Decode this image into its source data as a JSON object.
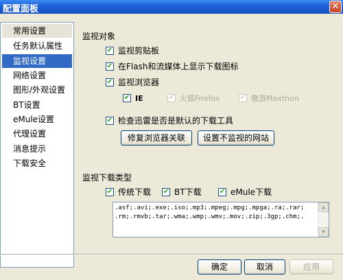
{
  "window": {
    "title": "配置面板",
    "close_icon": "✕"
  },
  "nav": {
    "items": [
      {
        "label": "常用设置"
      },
      {
        "label": "任务默认属性"
      },
      {
        "label": "监视设置"
      },
      {
        "label": "网络设置"
      },
      {
        "label": "图形/外观设置"
      },
      {
        "label": "BT设置"
      },
      {
        "label": "eMule设置"
      },
      {
        "label": "代理设置"
      },
      {
        "label": "消息提示"
      },
      {
        "label": "下载安全"
      }
    ],
    "selected": "监视设置"
  },
  "monitor_objects": {
    "title": "监视对象",
    "clipboard": {
      "label": "监视剪贴板",
      "checked": true
    },
    "flash": {
      "label": "在Flash和流媒体上显示下载图标",
      "checked": true
    },
    "browser": {
      "label": "监视浏览器",
      "checked": true
    },
    "ie": {
      "label": "IE",
      "checked": true
    },
    "firefox": {
      "label": "火狐Firefox",
      "checked": true,
      "disabled": true
    },
    "maxthon": {
      "label": "傲游Maxthon",
      "checked": true,
      "disabled": true
    },
    "default_tool": {
      "label": "检查迅雷是否是默认的下载工具",
      "checked": true
    },
    "repair_button": "修复浏览器关联",
    "unmonitored_sites_button": "设置不监视的网站"
  },
  "download_types": {
    "title": "监视下载类型",
    "traditional": {
      "label": "传统下载",
      "checked": true
    },
    "bt": {
      "label": "BT下载",
      "checked": true
    },
    "emule": {
      "label": "eMule下载",
      "checked": true
    },
    "extensions_line1": ".asf;.avi;.exe;.iso;.mp3;.mpeg;.mpg;.mpga;.ra;.rar;",
    "extensions_line2": ".rm;.rmvb;.tar;.wma;.wmp;.wmv;.mov;.zip;.3gp;.chm;."
  },
  "footer": {
    "ok": "确定",
    "cancel": "取消",
    "apply": "应用"
  },
  "check_glyph": "✔"
}
